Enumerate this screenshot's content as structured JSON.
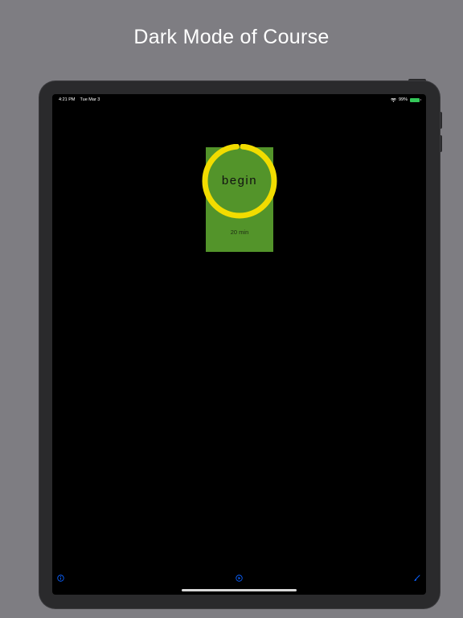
{
  "headline": "Dark Mode of Course",
  "status_bar": {
    "time": "4:21 PM",
    "date": "Tue Mar 3",
    "battery": "99%"
  },
  "course": {
    "action_label": "begin",
    "duration": "20 min",
    "progress": 0.97
  },
  "toolbar": {
    "icons": [
      "info-icon",
      "play-icon",
      "brush-icon"
    ]
  },
  "colors": {
    "background": "#7e7d82",
    "screen": "#000000",
    "card": "#53942a",
    "ring": "#f2dc00",
    "accent": "#0a60ff"
  }
}
